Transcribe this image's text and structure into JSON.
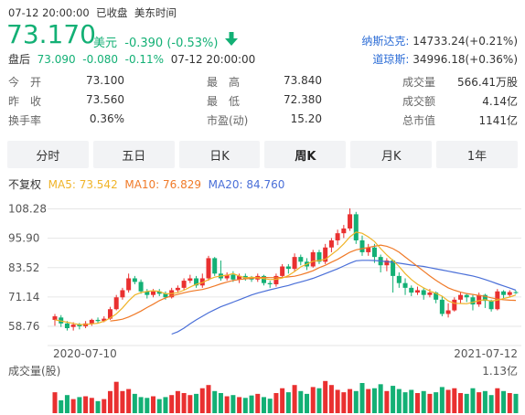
{
  "header": {
    "datetime": "07-12 20:00:00",
    "status": "已收盘",
    "timezone": "美东时间",
    "price": "73.170",
    "currency": "美元",
    "change": "-0.390",
    "change_pct": "(-0.53%)",
    "direction_icon": "arrow-down-icon",
    "after_hours_label": "盘后",
    "after_hours_price": "73.090",
    "after_hours_change": "-0.080",
    "after_hours_pct": "-0.11%",
    "after_hours_time": "07-12 20:00:00"
  },
  "indices": [
    {
      "name": "纳斯达克:",
      "value": "14733.24(+0.21%)"
    },
    {
      "name": "道琼斯:",
      "value": "34996.18(+0.36%)"
    }
  ],
  "stats": [
    {
      "label": "今　开",
      "value": "73.100",
      "color": "down"
    },
    {
      "label": "最　高",
      "value": "73.840",
      "color": "up"
    },
    {
      "label": "成交量",
      "value": "566.41万股",
      "color": "plain"
    },
    {
      "label": "昨　收",
      "value": "73.560",
      "color": "plain"
    },
    {
      "label": "最　低",
      "value": "72.380",
      "color": "down"
    },
    {
      "label": "成交额",
      "value": "4.14亿",
      "color": "plain"
    },
    {
      "label": "换手率",
      "value": "0.36%",
      "color": "plain"
    },
    {
      "label": "市盈(动)",
      "value": "15.20",
      "color": "plain"
    },
    {
      "label": "总市值",
      "value": "1141亿",
      "color": "plain"
    }
  ],
  "tabs": [
    {
      "label": "分时",
      "active": false
    },
    {
      "label": "五日",
      "active": false
    },
    {
      "label": "日K",
      "active": false
    },
    {
      "label": "周K",
      "active": true
    },
    {
      "label": "月K",
      "active": false
    },
    {
      "label": "1年",
      "active": false
    }
  ],
  "legend": {
    "adjust": "不复权",
    "ma5": "MA5: 73.542",
    "ma10": "MA10: 76.829",
    "ma20": "MA20: 84.760"
  },
  "colors": {
    "up": "#e93030",
    "down": "#13b075",
    "ma5": "#f0b429",
    "ma10": "#f07a28",
    "ma20": "#4a6fd8",
    "index_blue": "#2b6cd6"
  },
  "chart_data": {
    "type": "candlestick",
    "y_ticks": [
      "108.28",
      "95.90",
      "83.52",
      "71.14",
      "58.76"
    ],
    "y_tick_values": [
      108.28,
      95.9,
      83.52,
      71.14,
      58.76
    ],
    "ylim": [
      53,
      110
    ],
    "x_labels": [
      "2020-07-10",
      "2021-07-12"
    ],
    "grid": true,
    "candles": [
      [
        61.5,
        63.0,
        59.0,
        64.0
      ],
      [
        62.5,
        60.0,
        58.5,
        63.5
      ],
      [
        60.0,
        58.0,
        57.0,
        61.0
      ],
      [
        58.5,
        59.5,
        57.0,
        60.5
      ],
      [
        59.5,
        58.8,
        57.5,
        60.2
      ],
      [
        58.8,
        60.0,
        58.0,
        61.0
      ],
      [
        60.0,
        61.5,
        59.0,
        62.0
      ],
      [
        61.5,
        61.0,
        60.0,
        62.5
      ],
      [
        61.0,
        62.0,
        60.5,
        63.0
      ],
      [
        62.0,
        66.0,
        61.5,
        67.0
      ],
      [
        66.0,
        71.0,
        65.5,
        72.0
      ],
      [
        71.0,
        74.0,
        70.0,
        75.0
      ],
      [
        74.0,
        79.0,
        73.0,
        81.0
      ],
      [
        79.0,
        77.5,
        76.5,
        80.0
      ],
      [
        77.5,
        73.5,
        72.5,
        78.5
      ],
      [
        73.5,
        72.0,
        70.5,
        74.5
      ],
      [
        72.0,
        73.5,
        71.0,
        74.5
      ],
      [
        73.5,
        72.5,
        71.5,
        74.5
      ],
      [
        72.5,
        71.0,
        70.0,
        73.5
      ],
      [
        71.0,
        74.0,
        70.5,
        75.0
      ],
      [
        74.0,
        75.0,
        73.0,
        76.0
      ],
      [
        75.0,
        78.0,
        74.0,
        79.0
      ],
      [
        78.0,
        79.0,
        77.0,
        80.5
      ],
      [
        79.0,
        76.0,
        75.0,
        80.0
      ],
      [
        76.0,
        79.0,
        75.0,
        81.0
      ],
      [
        79.0,
        87.5,
        78.0,
        88.5
      ],
      [
        87.5,
        81.0,
        80.0,
        88.0
      ],
      [
        81.0,
        79.0,
        78.0,
        86.5
      ],
      [
        79.0,
        80.5,
        78.0,
        81.5
      ],
      [
        80.5,
        78.5,
        77.5,
        82.0
      ],
      [
        78.5,
        80.0,
        77.0,
        81.0
      ],
      [
        80.0,
        79.0,
        78.0,
        81.0
      ],
      [
        79.0,
        78.5,
        77.5,
        80.0
      ],
      [
        78.5,
        80.0,
        77.5,
        81.0
      ],
      [
        80.0,
        77.0,
        76.0,
        80.5
      ],
      [
        77.0,
        76.5,
        75.0,
        78.0
      ],
      [
        76.5,
        80.0,
        75.5,
        81.0
      ],
      [
        80.0,
        84.0,
        79.0,
        85.0
      ],
      [
        84.0,
        83.0,
        81.0,
        85.0
      ],
      [
        83.0,
        88.0,
        82.0,
        89.5
      ],
      [
        88.0,
        86.0,
        84.5,
        89.0
      ],
      [
        86.0,
        84.0,
        82.5,
        87.5
      ],
      [
        84.0,
        90.0,
        83.5,
        91.0
      ],
      [
        90.0,
        86.0,
        85.0,
        91.0
      ],
      [
        86.0,
        92.0,
        85.0,
        93.5
      ],
      [
        92.0,
        95.0,
        90.0,
        96.0
      ],
      [
        95.0,
        98.0,
        93.0,
        99.5
      ],
      [
        98.0,
        100.0,
        96.0,
        101.5
      ],
      [
        100.0,
        106.0,
        99.0,
        108.5
      ],
      [
        106.0,
        95.0,
        93.5,
        107.0
      ],
      [
        95.0,
        90.0,
        88.5,
        97.0
      ],
      [
        90.0,
        92.0,
        88.5,
        93.5
      ],
      [
        92.0,
        88.0,
        85.5,
        93.5
      ],
      [
        88.0,
        84.5,
        81.5,
        89.0
      ],
      [
        84.5,
        86.5,
        82.0,
        87.5
      ],
      [
        86.5,
        80.0,
        73.0,
        87.0
      ],
      [
        80.0,
        77.0,
        75.0,
        81.5
      ],
      [
        77.0,
        75.0,
        72.0,
        79.0
      ],
      [
        75.0,
        73.0,
        71.5,
        76.0
      ],
      [
        73.0,
        74.0,
        72.0,
        75.5
      ],
      [
        74.0,
        72.0,
        70.0,
        75.0
      ],
      [
        72.0,
        73.0,
        71.0,
        74.5
      ],
      [
        73.0,
        70.0,
        68.5,
        73.5
      ],
      [
        70.0,
        64.0,
        63.0,
        71.5
      ],
      [
        64.0,
        65.5,
        62.5,
        68.5
      ],
      [
        65.5,
        70.0,
        65.0,
        71.0
      ],
      [
        70.0,
        72.0,
        68.5,
        73.0
      ],
      [
        72.0,
        71.0,
        69.0,
        72.5
      ],
      [
        71.0,
        68.0,
        65.5,
        72.0
      ],
      [
        68.0,
        72.0,
        67.0,
        73.0
      ],
      [
        72.0,
        69.5,
        66.5,
        72.5
      ],
      [
        69.5,
        66.0,
        65.0,
        70.0
      ],
      [
        66.0,
        73.5,
        65.5,
        74.5
      ],
      [
        73.5,
        72.0,
        70.5,
        74.0
      ],
      [
        72.0,
        73.2,
        71.0,
        74.0
      ],
      [
        73.2,
        73.17,
        72.4,
        73.84
      ]
    ],
    "ma5": [
      61.5,
      61.0,
      60.5,
      60.0,
      59.5,
      59.6,
      59.8,
      60.1,
      60.9,
      62.3,
      64.0,
      66.5,
      69.5,
      72.0,
      73.0,
      73.5,
      73.8,
      73.5,
      72.5,
      72.6,
      73.0,
      74.0,
      75.3,
      76.5,
      77.2,
      78.5,
      79.5,
      80.0,
      80.3,
      81.0,
      80.0,
      79.2,
      79.5,
      79.2,
      78.9,
      78.5,
      78.6,
      79.1,
      80.2,
      81.9,
      83.8,
      85.0,
      86.2,
      86.5,
      87.0,
      89.0,
      91.0,
      93.5,
      96.5,
      98.5,
      98.0,
      96.5,
      94.5,
      91.5,
      88.8,
      86.5,
      84.0,
      81.0,
      78.5,
      76.5,
      75.0,
      73.7,
      72.7,
      71.5,
      69.5,
      68.5,
      68.4,
      68.3,
      68.9,
      69.6,
      70.0,
      69.4,
      69.8,
      70.5,
      71.1,
      72.0
    ],
    "ma10": [
      null,
      null,
      null,
      null,
      null,
      null,
      null,
      null,
      null,
      61.0,
      61.3,
      61.8,
      62.7,
      63.9,
      65.2,
      66.7,
      68.1,
      69.6,
      70.8,
      71.6,
      72.2,
      72.9,
      73.5,
      73.9,
      74.3,
      75.0,
      75.8,
      76.7,
      77.4,
      78.1,
      78.5,
      78.8,
      79.0,
      79.3,
      79.4,
      79.3,
      79.3,
      79.4,
      79.6,
      79.9,
      80.5,
      81.3,
      82.2,
      83.5,
      84.5,
      85.8,
      87.0,
      88.5,
      90.0,
      91.0,
      91.5,
      92.0,
      92.5,
      93.0,
      92.5,
      91.5,
      90.0,
      88.0,
      86.0,
      84.0,
      82.0,
      80.0,
      78.2,
      76.5,
      75.0,
      74.0,
      73.2,
      72.6,
      72.2,
      71.8,
      71.4,
      70.8,
      70.3,
      70.0,
      69.8,
      69.7
    ],
    "ma20": [
      null,
      null,
      null,
      null,
      null,
      null,
      null,
      null,
      null,
      null,
      null,
      null,
      null,
      null,
      null,
      null,
      null,
      null,
      null,
      55.5,
      56.5,
      58.0,
      59.8,
      61.5,
      63.0,
      64.5,
      65.8,
      67.0,
      68.0,
      69.0,
      70.0,
      71.0,
      72.0,
      72.8,
      73.5,
      74.2,
      74.8,
      75.4,
      76.0,
      76.8,
      77.5,
      78.2,
      79.0,
      80.0,
      81.0,
      82.0,
      83.0,
      84.2,
      85.4,
      86.4,
      86.6,
      86.6,
      86.5,
      86.3,
      86.0,
      85.8,
      85.4,
      85.0,
      84.6,
      84.3,
      84.0,
      83.5,
      83.0,
      82.5,
      82.0,
      81.5,
      81.0,
      80.5,
      80.0,
      79.3,
      78.5,
      77.6,
      76.7,
      75.8,
      74.9,
      74.0
    ],
    "volume_label": "成交量(股)",
    "volume_max_label": "1.13亿",
    "volumes": [
      0.52,
      0.32,
      0.45,
      0.35,
      0.4,
      0.42,
      0.38,
      0.3,
      0.35,
      0.55,
      0.78,
      0.55,
      0.6,
      0.48,
      0.4,
      0.38,
      0.42,
      0.35,
      0.4,
      0.45,
      0.55,
      0.5,
      0.45,
      0.48,
      0.62,
      0.7,
      0.55,
      0.5,
      0.42,
      0.45,
      0.4,
      0.38,
      0.44,
      0.48,
      0.4,
      0.36,
      0.5,
      0.62,
      0.52,
      0.7,
      0.55,
      0.48,
      0.65,
      0.62,
      0.8,
      0.7,
      0.58,
      0.52,
      0.6,
      0.55,
      0.75,
      0.6,
      0.62,
      0.72,
      0.55,
      0.68,
      0.6,
      0.52,
      0.58,
      0.5,
      0.55,
      0.48,
      0.52,
      0.65,
      0.58,
      0.62,
      0.5,
      0.48,
      0.62,
      0.52,
      0.55,
      0.45,
      0.62,
      0.55,
      0.5,
      0.48
    ]
  }
}
